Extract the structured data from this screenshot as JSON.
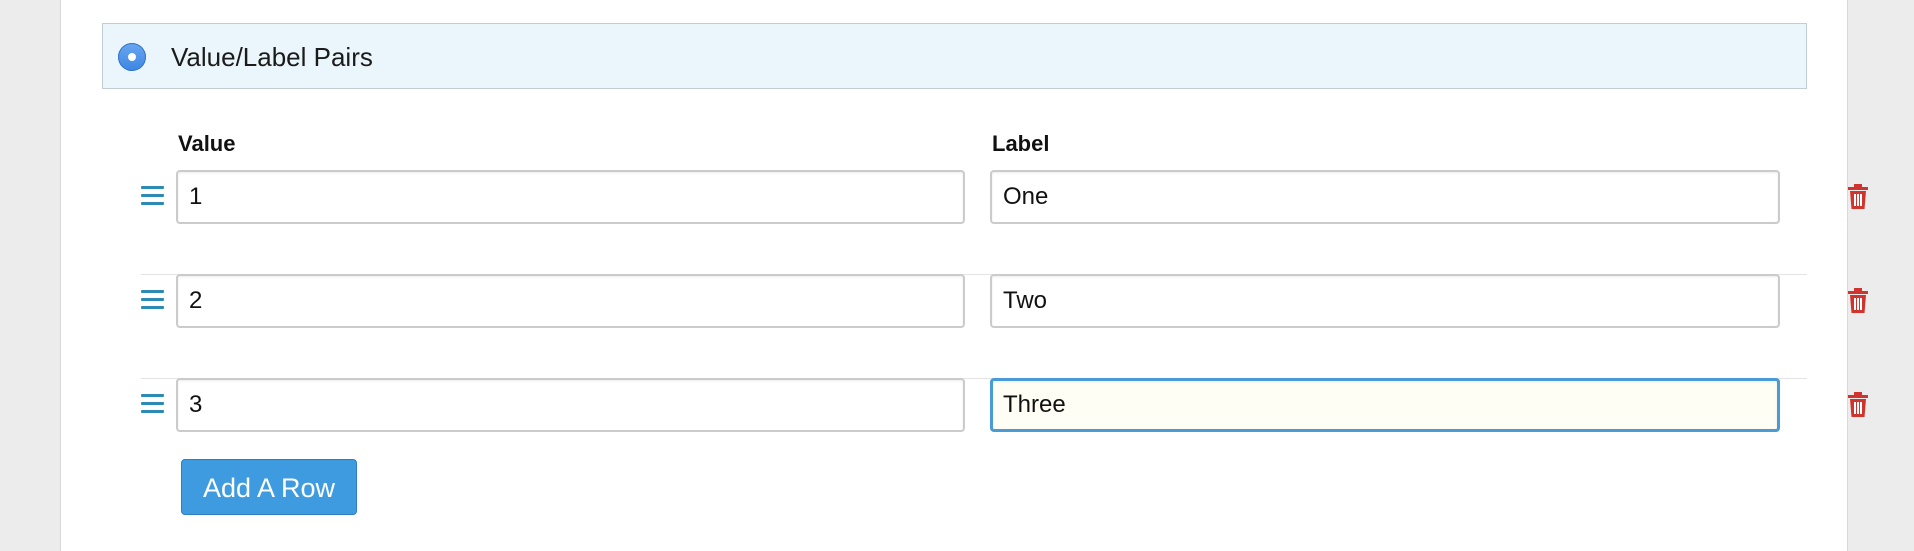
{
  "section": {
    "title": "Value/Label Pairs",
    "selected": true
  },
  "columns": {
    "value": "Value",
    "label": "Label"
  },
  "rows": [
    {
      "value": "1",
      "label": "One",
      "focused": false
    },
    {
      "value": "2",
      "label": "Two",
      "focused": false
    },
    {
      "value": "3",
      "label": "Three",
      "focused": true
    }
  ],
  "add_button_label": "Add A Row",
  "icons": {
    "drag": "drag-handle-icon",
    "delete": "trash-icon",
    "radio": "radio-selected-icon"
  },
  "colors": {
    "accent": "#3f9be0",
    "header_bg": "#eaf6fc",
    "delete": "#d0342c",
    "handle": "#2b8bb4",
    "focus_border": "#4a9ad6"
  }
}
